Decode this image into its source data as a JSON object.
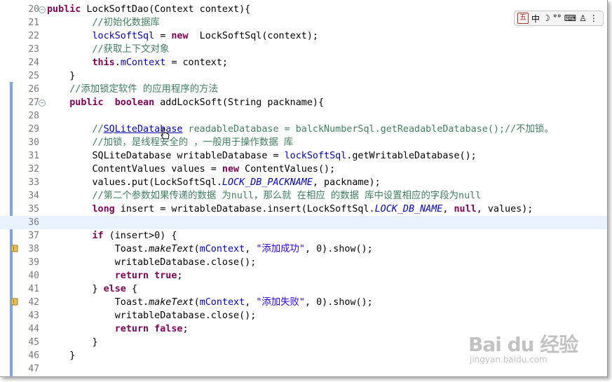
{
  "editor": {
    "lines": [
      {
        "n": "20",
        "segs": [
          [
            "kw",
            "public"
          ],
          [
            "",
            " LockSoftDao(Context context){"
          ]
        ]
      },
      {
        "n": "21",
        "segs": [
          [
            "",
            "        "
          ],
          [
            "cm",
            "//初始化数据库"
          ]
        ]
      },
      {
        "n": "22",
        "segs": [
          [
            "",
            "        "
          ],
          [
            "fld",
            "lockSoftSql"
          ],
          [
            "",
            " = "
          ],
          [
            "kw",
            "new"
          ],
          [
            "",
            "  LockSoftSql(context);"
          ]
        ]
      },
      {
        "n": "23",
        "segs": [
          [
            "",
            "        "
          ],
          [
            "cm",
            "//获取上下文对象"
          ]
        ]
      },
      {
        "n": "24",
        "segs": [
          [
            "",
            "        "
          ],
          [
            "kw",
            "this"
          ],
          [
            "",
            "."
          ],
          [
            "fld",
            "mContext"
          ],
          [
            "",
            " = context;"
          ]
        ]
      },
      {
        "n": "25",
        "segs": [
          [
            "",
            "    }"
          ]
        ]
      },
      {
        "n": "26",
        "segs": [
          [
            "",
            "    "
          ],
          [
            "cm",
            "//添加锁定软件 的应用程序的方法"
          ]
        ]
      },
      {
        "n": "27",
        "segs": [
          [
            "",
            "    "
          ],
          [
            "kw",
            "public"
          ],
          [
            "",
            "  "
          ],
          [
            "kw",
            "boolean"
          ],
          [
            "",
            " addLockSoft(String packname){"
          ]
        ]
      },
      {
        "n": "28",
        "segs": []
      },
      {
        "n": "29",
        "segs": [
          [
            "",
            "        "
          ],
          [
            "cm",
            "//"
          ],
          [
            "lnk",
            "SQLiteDatabase"
          ],
          [
            "cm",
            " readableDatabase = balckNumberSql.getReadableDatabase();//不加锁。"
          ]
        ]
      },
      {
        "n": "30",
        "segs": [
          [
            "",
            "        "
          ],
          [
            "cm",
            "//加锁，是线程安全的 ，一般用于操作数据 库"
          ]
        ]
      },
      {
        "n": "31",
        "segs": [
          [
            "",
            "        SQLiteDatabase writableDatabase = "
          ],
          [
            "fld",
            "lockSoftSql"
          ],
          [
            "",
            ".getWritableDatabase();"
          ]
        ]
      },
      {
        "n": "32",
        "segs": [
          [
            "",
            "        ContentValues values = "
          ],
          [
            "kw",
            "new"
          ],
          [
            "",
            " ContentValues();"
          ]
        ]
      },
      {
        "n": "33",
        "segs": [
          [
            "",
            "        values.put(LockSoftSql."
          ],
          [
            "stf",
            "LOCK_DB_PACKNAME"
          ],
          [
            "",
            ", packname);"
          ]
        ]
      },
      {
        "n": "34",
        "segs": [
          [
            "",
            "        "
          ],
          [
            "cm",
            "//第二个参数如果传递的数据 为null，那么就 在相应 的数据 库中设置相应的字段为null"
          ]
        ]
      },
      {
        "n": "35",
        "segs": [
          [
            "",
            "        "
          ],
          [
            "kw",
            "long"
          ],
          [
            "",
            " insert = writableDatabase.insert(LockSoftSql."
          ],
          [
            "stf",
            "LOCK_DB_NAME"
          ],
          [
            "",
            ", "
          ],
          [
            "kw",
            "null"
          ],
          [
            "",
            ", values);"
          ]
        ]
      },
      {
        "n": "36",
        "segs": []
      },
      {
        "n": "37",
        "segs": [
          [
            "",
            "        "
          ],
          [
            "kw",
            "if"
          ],
          [
            "",
            " (insert>0) {"
          ]
        ]
      },
      {
        "n": "38",
        "segs": [
          [
            "",
            "            Toast."
          ],
          [
            "mi",
            "makeText"
          ],
          [
            "",
            "("
          ],
          [
            "fld",
            "mContext"
          ],
          [
            "",
            ", "
          ],
          [
            "st",
            "\"添加成功\""
          ],
          [
            "",
            ", 0).show();"
          ]
        ]
      },
      {
        "n": "39",
        "segs": [
          [
            "",
            "            writableDatabase.close();"
          ]
        ]
      },
      {
        "n": "40",
        "segs": [
          [
            "",
            "            "
          ],
          [
            "kw",
            "return"
          ],
          [
            "",
            ""
          ],
          [
            "kw",
            " true"
          ],
          [
            "",
            ";"
          ]
        ]
      },
      {
        "n": "41",
        "segs": [
          [
            "",
            "        } "
          ],
          [
            "kw",
            "else"
          ],
          [
            "",
            " {"
          ]
        ]
      },
      {
        "n": "42",
        "segs": [
          [
            "",
            "            Toast."
          ],
          [
            "mi",
            "makeText"
          ],
          [
            "",
            "("
          ],
          [
            "fld",
            "mContext"
          ],
          [
            "",
            ", "
          ],
          [
            "st",
            "\"添加失败\""
          ],
          [
            "",
            ", 0).show();"
          ]
        ]
      },
      {
        "n": "43",
        "segs": [
          [
            "",
            "            writableDatabase.close();"
          ]
        ]
      },
      {
        "n": "44",
        "segs": [
          [
            "",
            "            "
          ],
          [
            "kw",
            "return"
          ],
          [
            "kw",
            " false"
          ],
          [
            "",
            ";"
          ]
        ]
      },
      {
        "n": "45",
        "segs": [
          [
            "",
            "        }"
          ]
        ]
      },
      {
        "n": "46",
        "segs": [
          [
            "",
            "    }"
          ]
        ]
      },
      {
        "n": "47",
        "segs": []
      }
    ]
  },
  "ime_toolbar": {
    "items": [
      "五",
      "中",
      "☽",
      "°°",
      "⌨",
      "♙",
      "⋮"
    ]
  },
  "watermark": {
    "brand": "Bai du 经验",
    "url": "jingyan.baidu.com"
  },
  "colors": {
    "keyword": "#7f0055",
    "comment": "#3f7f5f",
    "field": "#0000c0",
    "string": "#2a00ff",
    "current_line": "#e8f2fe",
    "change_bar": "#7fa6d8"
  }
}
